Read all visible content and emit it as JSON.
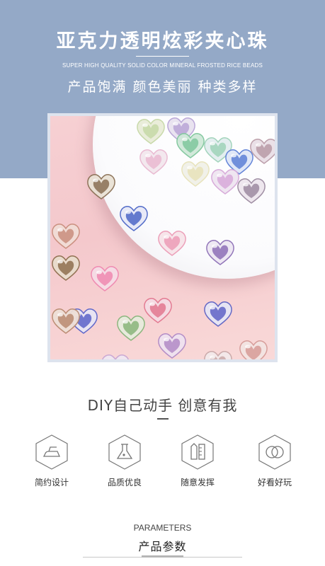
{
  "header": {
    "title": "亚克力透明炫彩夹心珠",
    "subtitle_en": "SUPER HIGH QUALITY SOLID COLOR MINERAL FROSTED RICE BEADS",
    "tagline": "产品饱满  颜色美丽  种类多样",
    "band_color": "#94a9c7"
  },
  "diy": {
    "title": "DIY自己动手 创意有我"
  },
  "features": [
    {
      "icon": "iron-icon",
      "label": "简约设计"
    },
    {
      "icon": "flask-icon",
      "label": "品质优良"
    },
    {
      "icon": "pencil-ruler-icon",
      "label": "随意发挥"
    },
    {
      "icon": "rings-icon",
      "label": "好看好玩"
    }
  ],
  "parameters": {
    "title_en": "PARAMETERS",
    "title_cn": "产品参数"
  }
}
